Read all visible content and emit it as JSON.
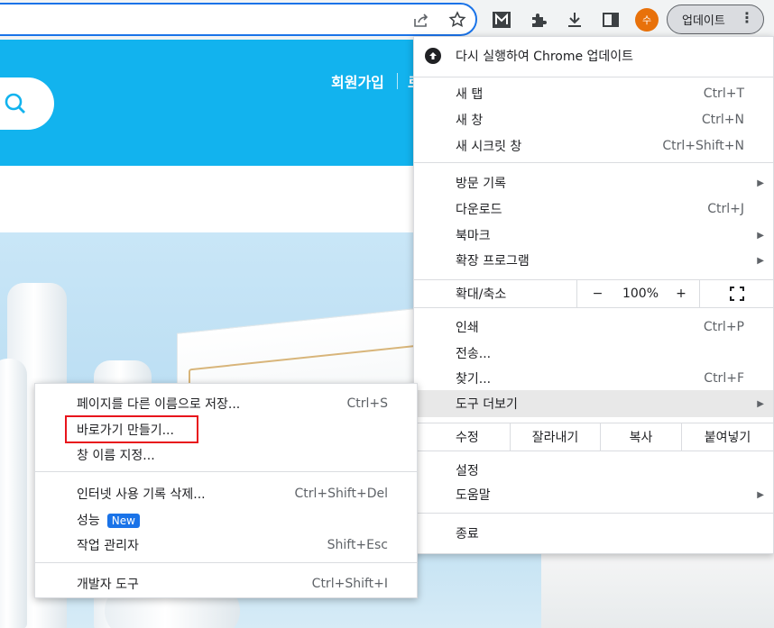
{
  "browser": {
    "avatar_initial": "수",
    "update_button_label": "업데이트",
    "more_icon": "⋮"
  },
  "page": {
    "header": {
      "join_label": "회원가입",
      "next_label": "로"
    }
  },
  "chrome_menu": {
    "update_label": "다시 실행하여 Chrome 업데이트",
    "new_tab": {
      "label": "새 탭",
      "shortcut": "Ctrl+T"
    },
    "new_window": {
      "label": "새 창",
      "shortcut": "Ctrl+N"
    },
    "incognito": {
      "label": "새 시크릿 창",
      "shortcut": "Ctrl+Shift+N"
    },
    "history": {
      "label": "방문 기록"
    },
    "downloads": {
      "label": "다운로드",
      "shortcut": "Ctrl+J"
    },
    "bookmarks": {
      "label": "북마크"
    },
    "extensions": {
      "label": "확장 프로그램"
    },
    "zoom": {
      "label": "확대/축소",
      "minus": "−",
      "value": "100%",
      "plus": "+"
    },
    "print": {
      "label": "인쇄",
      "shortcut": "Ctrl+P"
    },
    "cast": {
      "label": "전송..."
    },
    "find": {
      "label": "찾기...",
      "shortcut": "Ctrl+F"
    },
    "more_tools": {
      "label": "도구 더보기"
    },
    "edit": {
      "label": "수정",
      "cut": "잘라내기",
      "copy": "복사",
      "paste": "붙여넣기"
    },
    "settings": {
      "label": "설정"
    },
    "help": {
      "label": "도움말"
    },
    "exit": {
      "label": "종료"
    }
  },
  "submenu": {
    "save_as": {
      "label": "페이지를 다른 이름으로 저장...",
      "shortcut": "Ctrl+S"
    },
    "create_shortcut": {
      "label": "바로가기 만들기..."
    },
    "name_window": {
      "label": "창 이름 지정..."
    },
    "clear_data": {
      "label": "인터넷 사용 기록 삭제...",
      "shortcut": "Ctrl+Shift+Del"
    },
    "performance": {
      "label": "성능",
      "badge": "New"
    },
    "task_manager": {
      "label": "작업 관리자",
      "shortcut": "Shift+Esc"
    },
    "dev_tools": {
      "label": "개발자 도구",
      "shortcut": "Ctrl+Shift+I"
    }
  },
  "colors": {
    "accent": "#1a73e8",
    "header_bg": "#12b3ee",
    "highlight_outline": "#e8141c",
    "avatar": "#e8710a"
  }
}
